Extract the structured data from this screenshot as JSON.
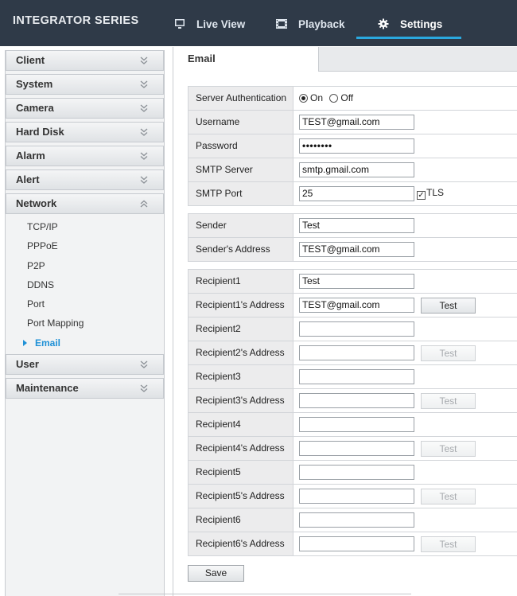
{
  "brand": "INTEGRATOR SERIES",
  "nav": {
    "live_view": "Live View",
    "playback": "Playback",
    "settings": "Settings"
  },
  "sidebar": {
    "sections": [
      {
        "label": "Client",
        "state": "collapsed"
      },
      {
        "label": "System",
        "state": "collapsed"
      },
      {
        "label": "Camera",
        "state": "collapsed"
      },
      {
        "label": "Hard Disk",
        "state": "collapsed"
      },
      {
        "label": "Alarm",
        "state": "collapsed"
      },
      {
        "label": "Alert",
        "state": "collapsed"
      },
      {
        "label": "Network",
        "state": "expanded"
      },
      {
        "label": "User",
        "state": "collapsed"
      },
      {
        "label": "Maintenance",
        "state": "collapsed"
      }
    ],
    "network_items": [
      "TCP/IP",
      "PPPoE",
      "P2P",
      "DDNS",
      "Port",
      "Port Mapping",
      "Email"
    ],
    "active_item": "Email"
  },
  "tab": "Email",
  "server": {
    "auth_label": "Server Authentication",
    "auth_on": "On",
    "auth_off": "Off",
    "auth_value": "On",
    "username_label": "Username",
    "username_value": "TEST@gmail.com",
    "password_label": "Password",
    "password_value": "••••••••",
    "smtp_server_label": "SMTP Server",
    "smtp_server_value": "smtp.gmail.com",
    "smtp_port_label": "SMTP Port",
    "smtp_port_value": "25",
    "tls_label": "TLS",
    "tls_checked": true
  },
  "sender": {
    "name_label": "Sender",
    "name_value": "Test",
    "address_label": "Sender's Address",
    "address_value": "TEST@gmail.com"
  },
  "recipients": [
    {
      "name_label": "Recipient1",
      "name_value": "Test",
      "address_label": "Recipient1's Address",
      "address_value": "TEST@gmail.com",
      "test_enabled": true
    },
    {
      "name_label": "Recipient2",
      "name_value": "",
      "address_label": "Recipient2's Address",
      "address_value": "",
      "test_enabled": false
    },
    {
      "name_label": "Recipient3",
      "name_value": "",
      "address_label": "Recipient3's Address",
      "address_value": "",
      "test_enabled": false
    },
    {
      "name_label": "Recipient4",
      "name_value": "",
      "address_label": "Recipient4's Address",
      "address_value": "",
      "test_enabled": false
    },
    {
      "name_label": "Recipient5",
      "name_value": "",
      "address_label": "Recipient5's Address",
      "address_value": "",
      "test_enabled": false
    },
    {
      "name_label": "Recipient6",
      "name_value": "",
      "address_label": "Recipient6's Address",
      "address_value": "",
      "test_enabled": false
    }
  ],
  "test_label": "Test",
  "save_label": "Save",
  "colors": {
    "topbar": "#2f3a48",
    "accent": "#2aa8df",
    "active_menu": "#1e90d6"
  }
}
